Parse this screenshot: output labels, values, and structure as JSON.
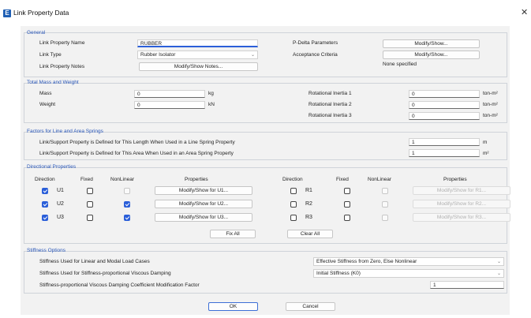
{
  "window": {
    "title": "Link Property Data",
    "icon_letter": "E",
    "close_glyph": "✕"
  },
  "general": {
    "title": "General",
    "name_label": "Link Property Name",
    "name_value": "RUBBER",
    "type_label": "Link Type",
    "type_value": "Rubber Isolator",
    "notes_label": "Link Property Notes",
    "notes_button": "Modify/Show Notes...",
    "pdelta_label": "P-Delta Parameters",
    "pdelta_button": "Modify/Show...",
    "acceptance_label": "Acceptance Criteria",
    "acceptance_button": "Modify/Show...",
    "acceptance_status": "None specified"
  },
  "mass": {
    "title": "Total Mass and Weight",
    "mass_label": "Mass",
    "mass_value": "0",
    "mass_unit": "kg",
    "weight_label": "Weight",
    "weight_value": "0",
    "weight_unit": "kN",
    "ri1_label": "Rotational Inertia 1",
    "ri1_value": "0",
    "ri1_unit": "ton-m²",
    "ri2_label": "Rotational Inertia 2",
    "ri2_value": "0",
    "ri2_unit": "ton-m²",
    "ri3_label": "Rotational Inertia 3",
    "ri3_value": "0",
    "ri3_unit": "ton-m²"
  },
  "factors": {
    "title": "Factors for Line and Area Springs",
    "line_label": "Link/Support Property is Defined for This Length When Used in a Line Spring Property",
    "line_value": "1",
    "line_unit": "m",
    "area_label": "Link/Support Property is Defined for This Area When Used in an Area Spring Property",
    "area_value": "1",
    "area_unit": "m²"
  },
  "directional": {
    "title": "Directional Properties",
    "headers": {
      "direction": "Direction",
      "fixed": "Fixed",
      "nonlinear": "NonLinear",
      "properties": "Properties"
    },
    "left_rows": [
      {
        "dir": "U1",
        "checked": true,
        "fixed": false,
        "nonlinear": false,
        "button": "Modify/Show for U1..."
      },
      {
        "dir": "U2",
        "checked": true,
        "fixed": false,
        "nonlinear": true,
        "button": "Modify/Show for U2..."
      },
      {
        "dir": "U3",
        "checked": true,
        "fixed": false,
        "nonlinear": true,
        "button": "Modify/Show for U3..."
      }
    ],
    "right_rows": [
      {
        "dir": "R1",
        "checked": false,
        "button": "Modify/Show for R1..."
      },
      {
        "dir": "R2",
        "checked": false,
        "button": "Modify/Show for R2..."
      },
      {
        "dir": "R3",
        "checked": false,
        "button": "Modify/Show for R3..."
      }
    ],
    "fix_all": "Fix All",
    "clear_all": "Clear All"
  },
  "stiffness": {
    "title": "Stiffness Options",
    "linear_label": "Stiffness Used for Linear and Modal Load Cases",
    "linear_value": "Effective Stiffness from Zero, Else Nonlinear",
    "damping_label": "Stiffness Used for Stiffness-proportional Viscous Damping",
    "damping_value": "Initial Stiffness (K0)",
    "factor_label": "Stiffness-proportional Viscous Damping Coefficient Modification Factor",
    "factor_value": "1"
  },
  "footer": {
    "ok": "OK",
    "cancel": "Cancel"
  }
}
